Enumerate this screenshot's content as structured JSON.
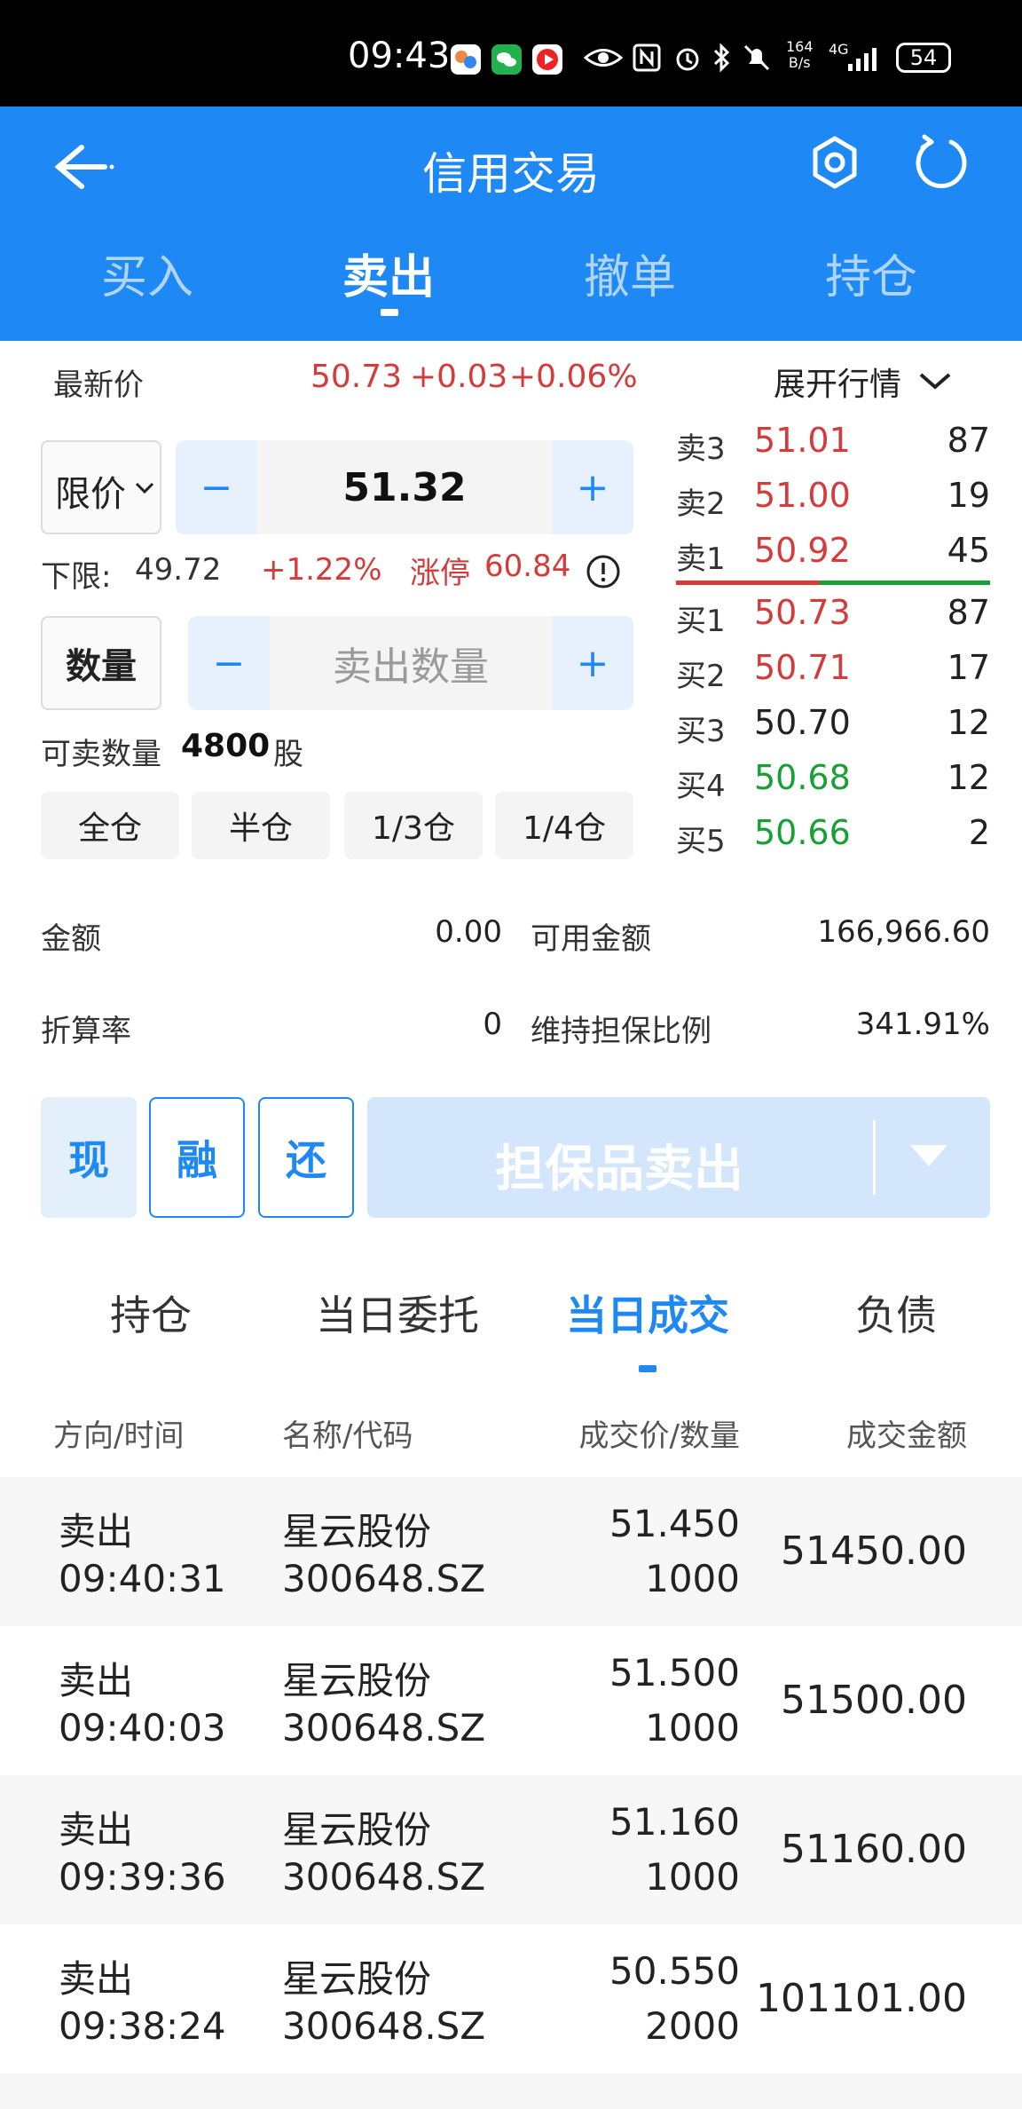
{
  "status_bar": {
    "time": "09:43",
    "net_speed_top": "164",
    "net_speed_bottom": "B/s",
    "network": "4G",
    "battery": "54"
  },
  "header": {
    "title": "信用交易",
    "tabs": [
      "买入",
      "卖出",
      "撤单",
      "持仓"
    ],
    "active_tab": 1
  },
  "quote": {
    "label": "最新价",
    "price": "50.73",
    "change": "+0.03",
    "change_pct": "+0.06%",
    "expand_label": "展开行情"
  },
  "order": {
    "price_type": "限价",
    "price_value": "51.32",
    "lower_limit_label": "下限:",
    "lower_limit_value": "49.72",
    "limit_pct": "+1.22%",
    "upper_limit_label": "涨停",
    "upper_limit_value": "60.84",
    "qty_label": "数量",
    "qty_placeholder": "卖出数量",
    "sellable_label": "可卖数量",
    "sellable_value": "4800",
    "sellable_unit": "股",
    "positions": [
      "全仓",
      "半仓",
      "1/3仓",
      "1/4仓"
    ],
    "minus": "−",
    "plus": "+"
  },
  "orderbook": {
    "asks": [
      {
        "label": "卖3",
        "price": "51.01",
        "vol": "87",
        "color": "red"
      },
      {
        "label": "卖2",
        "price": "51.00",
        "vol": "19",
        "color": "red"
      },
      {
        "label": "卖1",
        "price": "50.92",
        "vol": "45",
        "color": "red"
      }
    ],
    "bids": [
      {
        "label": "买1",
        "price": "50.73",
        "vol": "87",
        "color": "red"
      },
      {
        "label": "买2",
        "price": "50.71",
        "vol": "17",
        "color": "red"
      },
      {
        "label": "买3",
        "price": "50.70",
        "vol": "12",
        "color": "black"
      },
      {
        "label": "买4",
        "price": "50.68",
        "vol": "12",
        "color": "green"
      },
      {
        "label": "买5",
        "price": "50.66",
        "vol": "2",
        "color": "green"
      }
    ]
  },
  "info": {
    "amount_label": "金额",
    "amount_value": "0.00",
    "available_label": "可用金额",
    "available_value": "166,966.60",
    "rate_label": "折算率",
    "rate_value": "0",
    "ratio_label": "维持担保比例",
    "ratio_value": "341.91%"
  },
  "mode_buttons": [
    "现",
    "融",
    "还"
  ],
  "sell_button": "担保品卖出",
  "bottom_tabs": [
    "持仓",
    "当日委托",
    "当日成交",
    "负债"
  ],
  "active_bottom_tab": 2,
  "table": {
    "headers": [
      "方向/时间",
      "名称/代码",
      "成交价/数量",
      "成交金额"
    ],
    "rows": [
      {
        "direction": "卖出",
        "time": "09:40:31",
        "name": "星云股份",
        "code": "300648.SZ",
        "price": "51.450",
        "qty": "1000",
        "amount": "51450.00"
      },
      {
        "direction": "卖出",
        "time": "09:40:03",
        "name": "星云股份",
        "code": "300648.SZ",
        "price": "51.500",
        "qty": "1000",
        "amount": "51500.00"
      },
      {
        "direction": "卖出",
        "time": "09:39:36",
        "name": "星云股份",
        "code": "300648.SZ",
        "price": "51.160",
        "qty": "1000",
        "amount": "51160.00"
      },
      {
        "direction": "卖出",
        "time": "09:38:24",
        "name": "星云股份",
        "code": "300648.SZ",
        "price": "50.550",
        "qty": "2000",
        "amount": "101101.00"
      }
    ]
  },
  "colors": {
    "accent": "#1e88f4",
    "up": "#d43b3b",
    "down": "#18a035"
  },
  "icons": {
    "back": "back-arrow-icon",
    "settings": "gear-icon",
    "refresh": "refresh-icon",
    "expand": "chevron-down-icon",
    "info": "info-circle-icon",
    "dropdown": "caret-down-icon"
  }
}
